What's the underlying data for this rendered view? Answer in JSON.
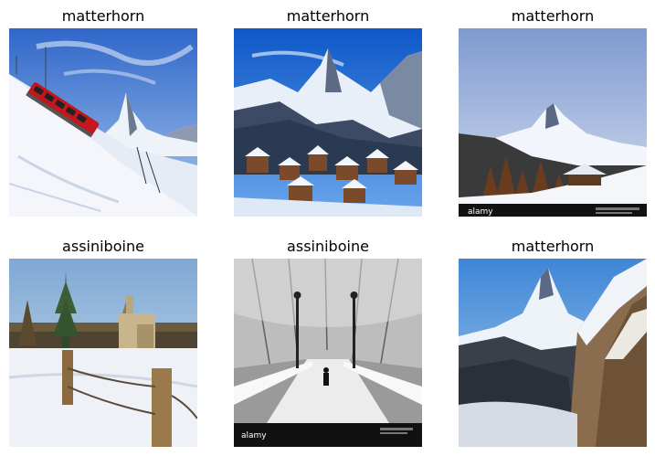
{
  "grid": {
    "images": [
      {
        "label": "matterhorn",
        "scene": "train-slope-matterhorn"
      },
      {
        "label": "matterhorn",
        "scene": "village-matterhorn"
      },
      {
        "label": "matterhorn",
        "scene": "chalet-matterhorn",
        "watermark": "alamy"
      },
      {
        "label": "assiniboine",
        "scene": "church-fence"
      },
      {
        "label": "assiniboine",
        "scene": "snowy-bridge",
        "watermark": "alamy"
      },
      {
        "label": "matterhorn",
        "scene": "cliff-matterhorn"
      }
    ]
  }
}
